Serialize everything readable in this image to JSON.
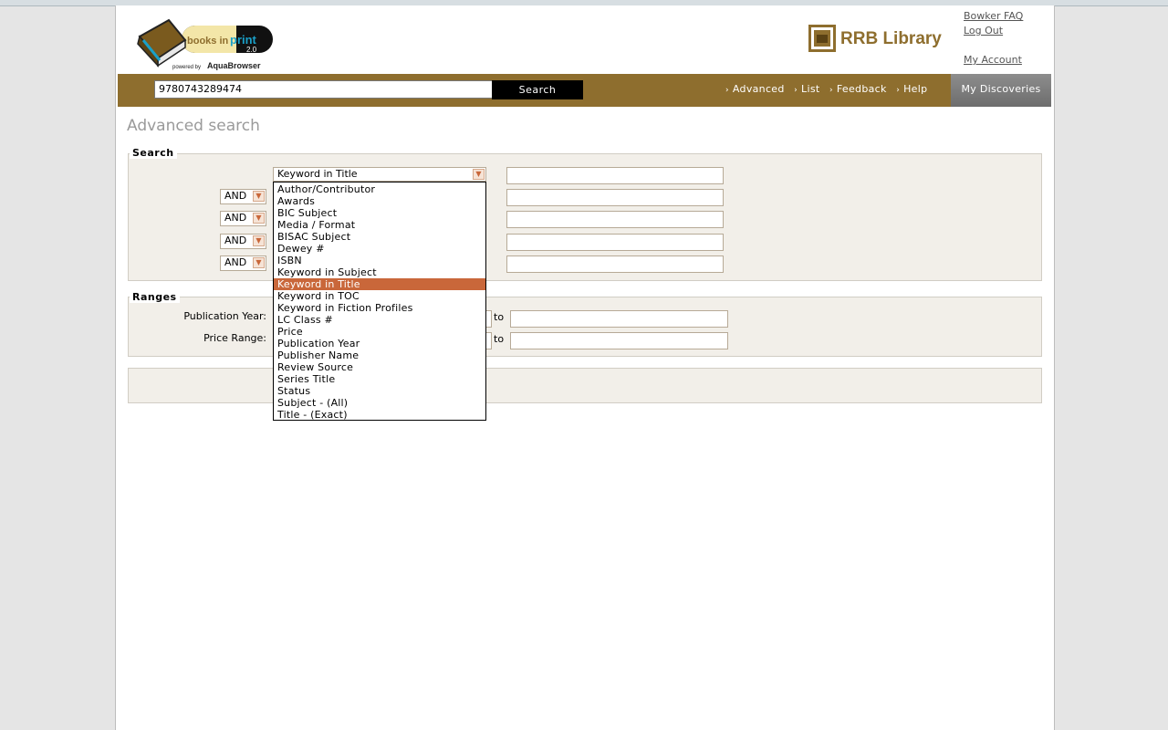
{
  "header": {
    "logo_main": "books in",
    "logo_print": "print",
    "logo_version": "2.0",
    "logo_powered": "powered by",
    "logo_brand": "AquaBrowser",
    "library_name": "RRB Library",
    "links": [
      "Bowker FAQ",
      "Log Out",
      "My Account"
    ]
  },
  "navbar": {
    "search_value": "9780743289474",
    "search_button": "Search",
    "links": [
      "Advanced",
      "List",
      "Feedback",
      "Help"
    ],
    "my_discoveries": "My Discoveries"
  },
  "page_title": "Advanced search",
  "search_section": {
    "legend": "Search",
    "first_field": "Keyword in Title",
    "operators": [
      "AND",
      "AND",
      "AND",
      "AND"
    ]
  },
  "ranges_section": {
    "legend": "Ranges",
    "publication_year_label": "Publication Year:",
    "price_range_label": "Price Range:",
    "to_label": "to"
  },
  "dropdown": {
    "options": [
      "Author/Contributor",
      "Awards",
      "BIC Subject",
      "Media / Format",
      "BISAC Subject",
      "Dewey #",
      "ISBN",
      "Keyword in Subject",
      "Keyword in Title",
      "Keyword in TOC",
      "Keyword in Fiction Profiles",
      "LC Class #",
      "Price",
      "Publication Year",
      "Publisher Name",
      "Review Source",
      "Series Title",
      "Status",
      "Subject - (All)",
      "Title - (Exact)"
    ],
    "selected_index": 8
  },
  "colors": {
    "brand": "#8e6e2e",
    "highlight": "#c9673a",
    "panel": "#f2efe9"
  }
}
